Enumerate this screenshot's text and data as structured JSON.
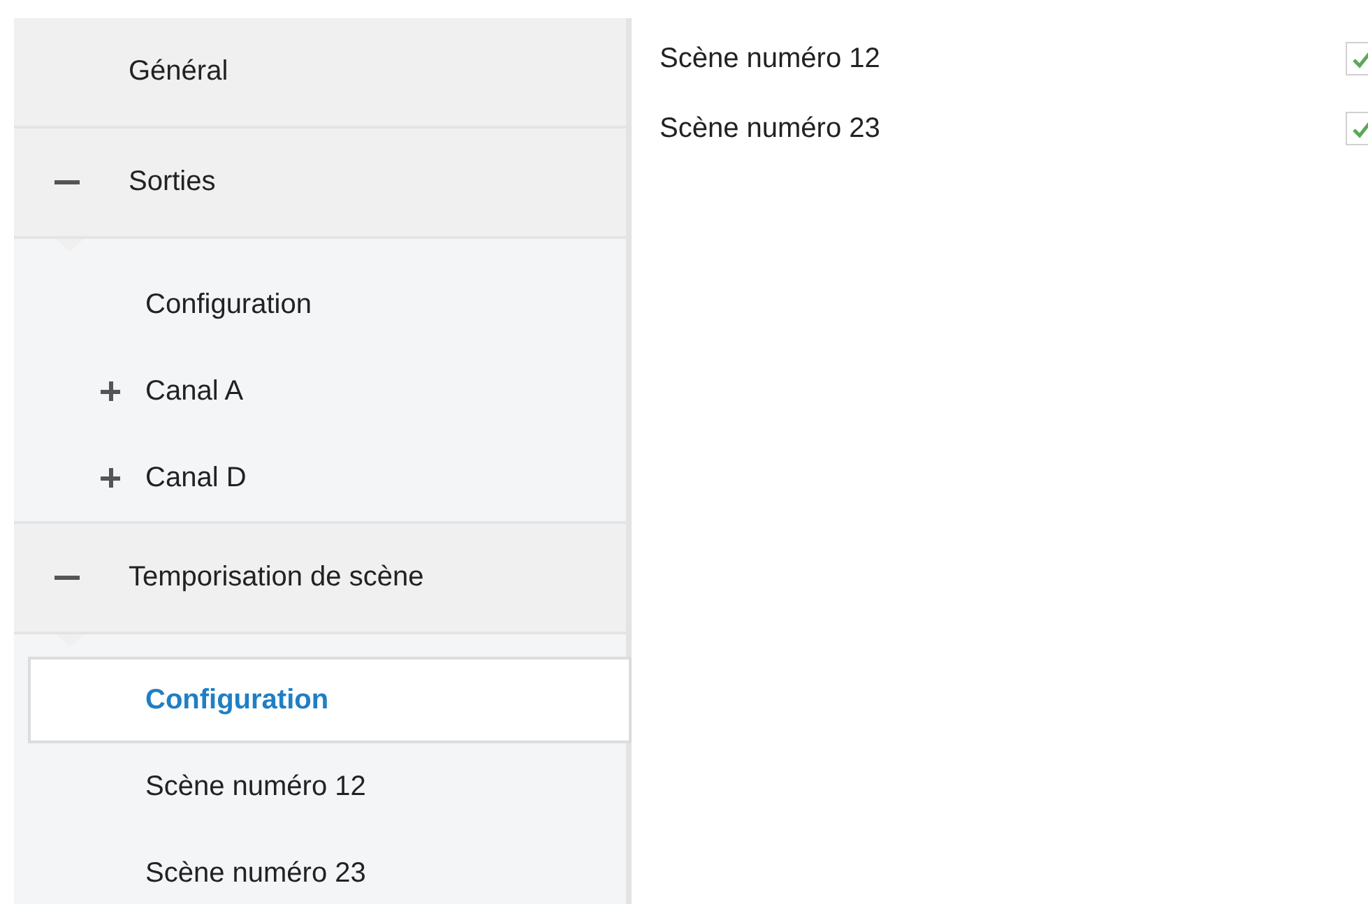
{
  "sidebar": {
    "items": [
      {
        "label": "Général",
        "selected": false
      },
      {
        "label": "Sorties",
        "expanded": true,
        "selected": false,
        "children": [
          {
            "label": "Configuration",
            "selected": false
          },
          {
            "label": "Canal A",
            "expanded": false,
            "selected": false
          },
          {
            "label": "Canal D",
            "expanded": false,
            "selected": false
          }
        ]
      },
      {
        "label": "Temporisation de scène",
        "expanded": true,
        "selected": false,
        "children": [
          {
            "label": "Configuration",
            "selected": true
          },
          {
            "label": "Scène numéro 12",
            "selected": false
          },
          {
            "label": "Scène numéro 23",
            "selected": false
          }
        ]
      }
    ]
  },
  "settings": [
    {
      "label": "Scène numéro 12",
      "checked": true
    },
    {
      "label": "Scène numéro 23",
      "checked": true
    }
  ]
}
